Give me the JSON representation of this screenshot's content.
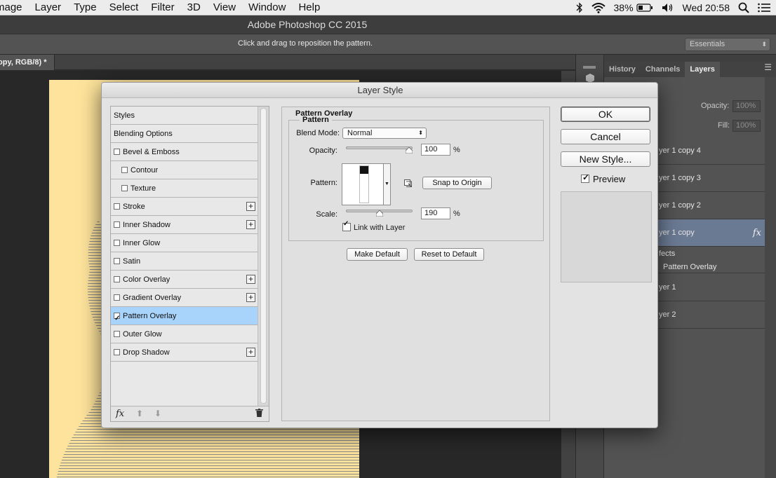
{
  "menubar": {
    "items": [
      "mage",
      "Layer",
      "Type",
      "Select",
      "Filter",
      "3D",
      "View",
      "Window",
      "Help"
    ],
    "battery": "38%",
    "clock": "Wed 20:58"
  },
  "app": {
    "title": "Adobe Photoshop CC 2015",
    "options_hint": "Click and drag to reposition the pattern.",
    "workspace": "Essentials",
    "doc_tab": "opy, RGB/8) *"
  },
  "layers_panel": {
    "tabs": [
      "History",
      "Channels",
      "Layers"
    ],
    "active_tab": "Layers",
    "opacity_label": "Opacity:",
    "opacity_value": "100%",
    "fill_label": "Fill:",
    "fill_value": "100%",
    "rows": [
      {
        "label": "yer 1 copy 4"
      },
      {
        "label": "yer 1 copy 3"
      },
      {
        "label": "yer 1 copy 2"
      },
      {
        "label": "yer 1 copy"
      },
      {
        "label": "yer 1"
      },
      {
        "label": "yer 2"
      }
    ],
    "effects_label": "fects",
    "effect_item": "Pattern Overlay",
    "fx": "fx"
  },
  "dialog": {
    "title": "Layer Style",
    "styles": [
      {
        "label": "Styles",
        "checkbox": false
      },
      {
        "label": "Blending Options",
        "checkbox": false
      },
      {
        "label": "Bevel & Emboss",
        "checkbox": true,
        "checked": false
      },
      {
        "label": "Contour",
        "checkbox": true,
        "checked": false,
        "sub": true
      },
      {
        "label": "Texture",
        "checkbox": true,
        "checked": false,
        "sub": true
      },
      {
        "label": "Stroke",
        "checkbox": true,
        "checked": false,
        "plus": true
      },
      {
        "label": "Inner Shadow",
        "checkbox": true,
        "checked": false,
        "plus": true
      },
      {
        "label": "Inner Glow",
        "checkbox": true,
        "checked": false
      },
      {
        "label": "Satin",
        "checkbox": true,
        "checked": false
      },
      {
        "label": "Color Overlay",
        "checkbox": true,
        "checked": false,
        "plus": true
      },
      {
        "label": "Gradient Overlay",
        "checkbox": true,
        "checked": false,
        "plus": true
      },
      {
        "label": "Pattern Overlay",
        "checkbox": true,
        "checked": true,
        "selected": true
      },
      {
        "label": "Outer Glow",
        "checkbox": true,
        "checked": false
      },
      {
        "label": "Drop Shadow",
        "checkbox": true,
        "checked": false,
        "plus": true
      }
    ],
    "footer_fx": "fx",
    "section_title": "Pattern Overlay",
    "group_title": "Pattern",
    "blend_mode_label": "Blend Mode:",
    "blend_mode_value": "Normal",
    "opacity_label": "Opacity:",
    "opacity_value": "100",
    "opacity_fraction": 1.0,
    "pattern_label": "Pattern:",
    "snap_button": "Snap to Origin",
    "scale_label": "Scale:",
    "scale_value": "190",
    "scale_fraction": 0.5,
    "percent": "%",
    "link_label": "Link with Layer",
    "link_checked": true,
    "make_default": "Make Default",
    "reset_default": "Reset to Default",
    "ok": "OK",
    "cancel": "Cancel",
    "new_style": "New Style...",
    "preview_label": "Preview",
    "preview_checked": true
  }
}
